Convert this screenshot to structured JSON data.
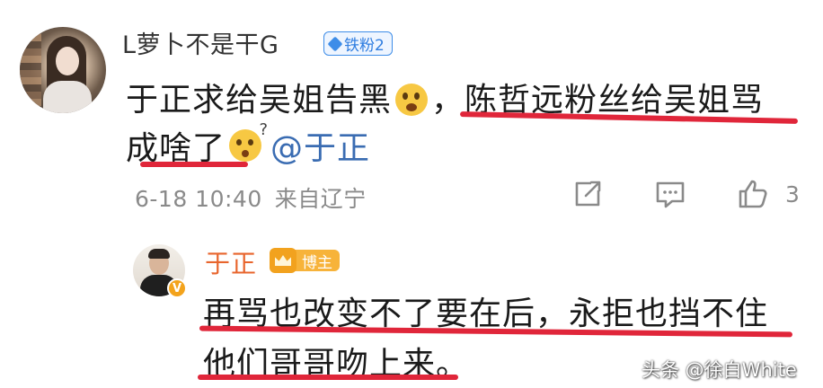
{
  "comment": {
    "username": "L萝卜不是干G",
    "fan_badge": "铁粉2",
    "text_part1": "于正求给吴姐告黑",
    "text_part2": "，陈哲远粉丝给吴姐骂",
    "text_part3": "成啥了",
    "mention": "@于正",
    "emoji_1": "scared-emoji",
    "emoji_2": "confused-emoji",
    "date": "6-18 10:40",
    "source": "来自辽宁",
    "like_count": "3"
  },
  "reply": {
    "username": "于正",
    "badge": "博主",
    "line1": "再骂也改变不了要在后，永拒也挡不住",
    "line2": "他们哥哥吻上来。",
    "verified_mark": "V"
  },
  "watermark": "头条 @徐白White",
  "colors": {
    "underline": "#e0263a",
    "mention": "#3a6cb2",
    "author_name": "#e8652d",
    "fan_badge": "#3e8de8",
    "host_badge": "#f2a21e"
  }
}
